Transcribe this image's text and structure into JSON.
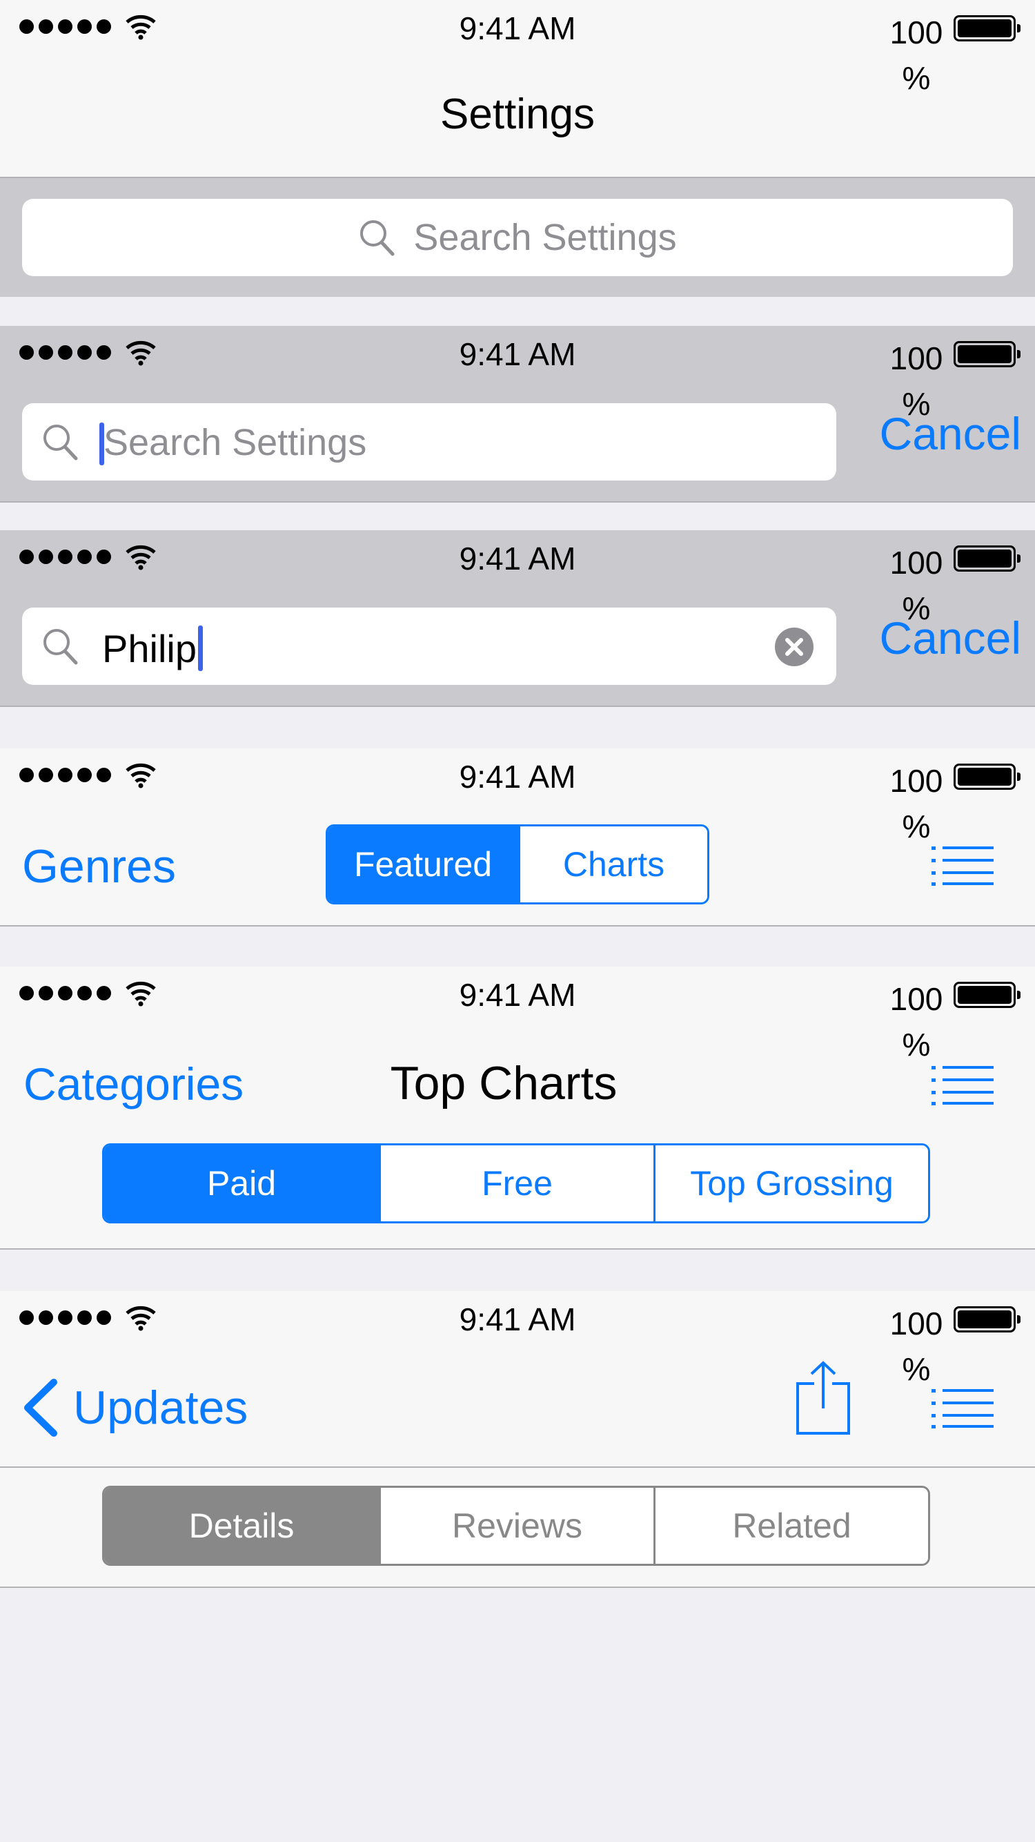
{
  "status": {
    "time": "9:41 AM",
    "battery_value": "100",
    "battery_unit": "%"
  },
  "colors": {
    "accent": "#0a7aff",
    "bar_gray": "#c9c9ce",
    "background": "#efeff4",
    "segment_gray": "#888888"
  },
  "settings_nav": {
    "title": "Settings",
    "search_placeholder": "Search Settings"
  },
  "search_active": {
    "placeholder": "Search Settings",
    "cancel_label": "Cancel"
  },
  "search_typed": {
    "query": "Philip",
    "cancel_label": "Cancel",
    "clear_icon": "clear-circle-icon"
  },
  "store_nav": {
    "left_label": "Genres",
    "segments": [
      "Featured",
      "Charts"
    ],
    "selected": "Featured",
    "right_icon": "list-icon"
  },
  "charts_nav": {
    "left_label": "Categories",
    "title": "Top Charts",
    "segments": [
      "Paid",
      "Free",
      "Top Grossing"
    ],
    "selected": "Paid",
    "right_icon": "list-icon"
  },
  "updates_nav": {
    "back_label": "Updates",
    "share_icon": "share-icon",
    "right_icon": "list-icon",
    "segments": [
      "Details",
      "Reviews",
      "Related"
    ],
    "selected": "Details"
  }
}
